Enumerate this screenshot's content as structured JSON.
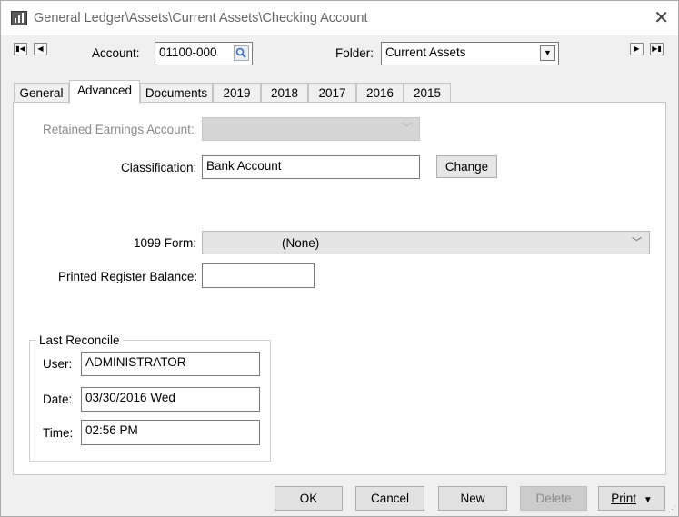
{
  "window": {
    "title": "General Ledger\\Assets\\Current Assets\\Checking Account"
  },
  "header": {
    "account_label": "Account:",
    "account_value": "01100-000",
    "folder_label": "Folder:",
    "folder_value": "Current Assets"
  },
  "tabs": [
    {
      "label": "General"
    },
    {
      "label": "Advanced",
      "active": true
    },
    {
      "label": "Documents"
    },
    {
      "label": "2019"
    },
    {
      "label": "2018"
    },
    {
      "label": "2017"
    },
    {
      "label": "2016"
    },
    {
      "label": "2015"
    }
  ],
  "form": {
    "retained_label": "Retained Earnings Account:",
    "retained_value": "",
    "classification_label": "Classification:",
    "classification_value": "Bank Account",
    "change_label": "Change",
    "form1099_label": "1099 Form:",
    "form1099_value": "(None)",
    "printed_balance_label": "Printed Register Balance:",
    "printed_balance_value": ""
  },
  "last_reconcile": {
    "title": "Last Reconcile",
    "user_label": "User:",
    "user_value": "ADMINISTRATOR",
    "date_label": "Date:",
    "date_value": "03/30/2016 Wed",
    "time_label": "Time:",
    "time_value": "02:56 PM"
  },
  "buttons": {
    "ok": "OK",
    "cancel": "Cancel",
    "new": "New",
    "delete": "Delete",
    "print": "Print"
  },
  "colors": {
    "disabled_text": "#8a8a8a",
    "panel_bg": "#ffffff",
    "window_bg": "#f0f0f0"
  },
  "icons": [
    "app-chart-icon",
    "close-icon",
    "first-record-icon",
    "previous-record-icon",
    "next-record-icon",
    "last-record-icon",
    "search-icon",
    "chevron-down-icon"
  ]
}
